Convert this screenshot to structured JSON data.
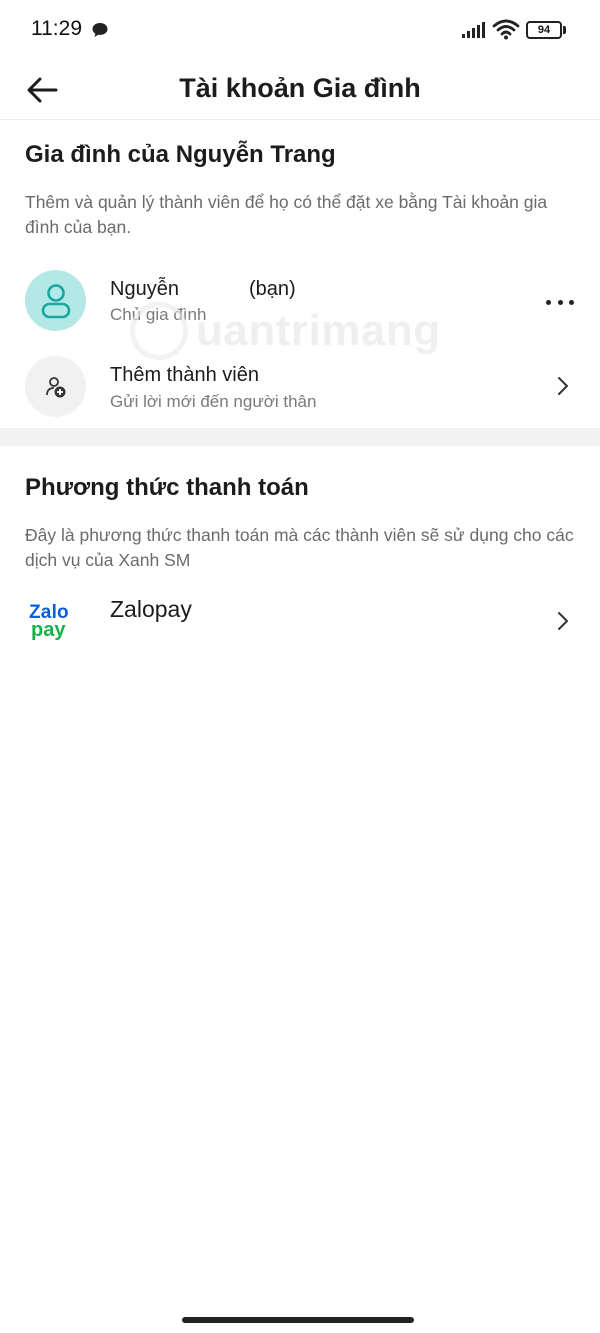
{
  "status_bar": {
    "time": "11:29",
    "battery": "94",
    "icons": [
      "chat-bubble-icon",
      "signal-icon",
      "wifi-icon",
      "battery-icon"
    ]
  },
  "header": {
    "title": "Tài khoản Gia đình",
    "back_icon": "arrow-left-icon"
  },
  "family": {
    "title": "Gia đình của Nguyễn Trang",
    "description": "Thêm và quản lý thành viên để họ có thể đặt xe bằng Tài khoản gia đình của bạn.",
    "owner": {
      "name": "Nguyễn",
      "you_tag": "(bạn)",
      "role": "Chủ gia đình",
      "avatar_icon": "user-icon",
      "avatar_bg": "#b3e8e6"
    },
    "add_member": {
      "title": "Thêm thành viên",
      "subtitle": "Gửi lời mới đến người thân",
      "icon": "add-user-icon"
    }
  },
  "payment": {
    "title": "Phương thức thanh toán",
    "description": "Đây là phương thức thanh toán mà các thành viên sẽ sử dụng cho các dịch vụ của Xanh SM",
    "method": {
      "name": "Zalopay",
      "logo_top": "Zalo",
      "logo_bottom": "pay",
      "logo_colors": {
        "zalo": "#0b5fd8",
        "pay": "#17b24a"
      }
    }
  },
  "watermark": {
    "text": "uantrimang"
  },
  "colors": {
    "accent_teal": "#1aa7a2",
    "divider": "#f2f2f2"
  }
}
